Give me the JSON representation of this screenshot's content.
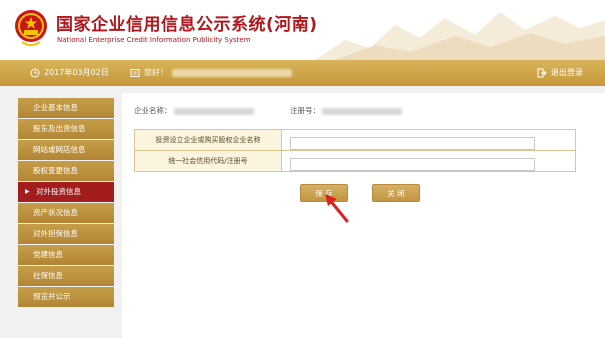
{
  "site": {
    "title": "国家企业信用信息公示系统(河南)",
    "subtitle": "National Enterprise Credit Information Publicity System"
  },
  "topbar": {
    "date": "2017年03月02日",
    "greeting": "您好！",
    "logout": "退出登录"
  },
  "sidebar": {
    "items": [
      {
        "label": "企业基本信息",
        "active": false
      },
      {
        "label": "股东及出资信息",
        "active": false
      },
      {
        "label": "网站或网店信息",
        "active": false
      },
      {
        "label": "股权变更信息",
        "active": false
      },
      {
        "label": "对外投资信息",
        "active": true
      },
      {
        "label": "资产状况信息",
        "active": false
      },
      {
        "label": "对外担保信息",
        "active": false
      },
      {
        "label": "党建信息",
        "active": false
      },
      {
        "label": "社保信息",
        "active": false
      },
      {
        "label": "预览并公示",
        "active": false
      }
    ]
  },
  "content": {
    "company_name_label": "企业名称：",
    "reg_no_label": "注册号：",
    "form": {
      "invest_company_label": "投资设立企业或购买股权企业名称",
      "invest_company_value": "",
      "credit_code_label": "统一社会信用代码/注册号",
      "credit_code_value": ""
    },
    "buttons": {
      "save": "保 存",
      "close": "关 闭"
    }
  },
  "colors": {
    "brand_red": "#b0171c",
    "gold": "#c6983a",
    "active_red": "#a31d1d"
  }
}
